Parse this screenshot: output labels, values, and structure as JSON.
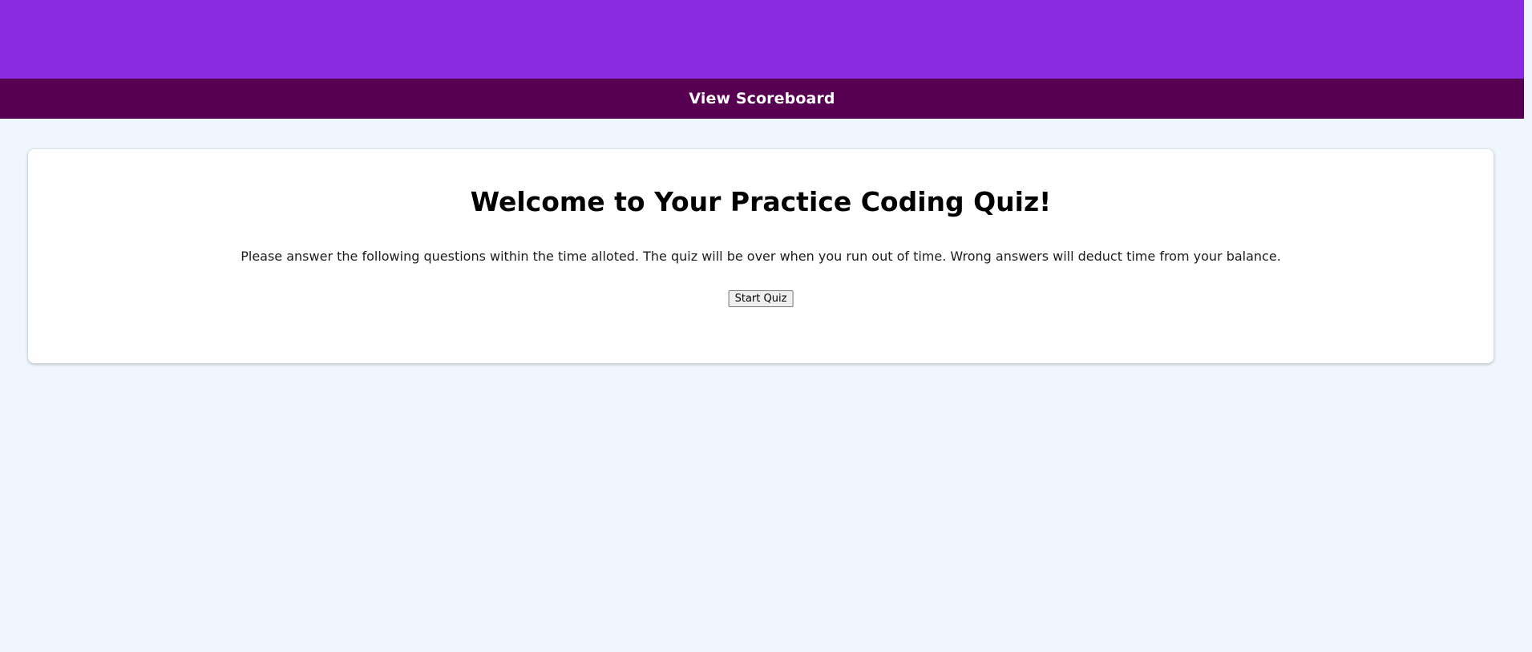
{
  "nav": {
    "scoreboard_label": "View Scoreboard"
  },
  "intro": {
    "title": "Welcome to Your Practice Coding Quiz!",
    "description": "Please answer the following questions within the time alloted. The quiz will be over when you run out of time. Wrong answers will deduct time from your balance.",
    "start_label": "Start Quiz"
  },
  "colors": {
    "banner": "#8a2be2",
    "nav": "#570052",
    "background": "#eff6fe",
    "card": "#ffffff"
  }
}
